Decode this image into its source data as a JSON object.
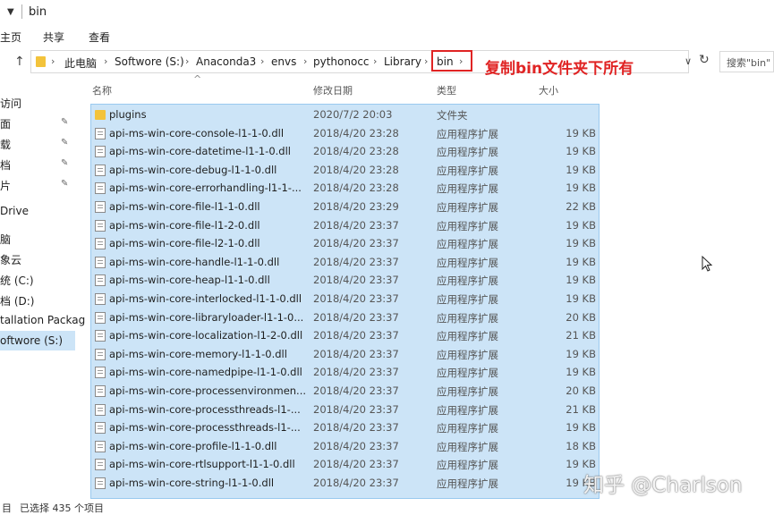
{
  "window": {
    "title": "bin"
  },
  "ribbon": {
    "tabs": [
      "主页",
      "共享",
      "查看"
    ]
  },
  "address": {
    "crumbs": [
      "此电脑",
      "Softwore (S:)",
      "Anaconda3",
      "envs",
      "pythonocc",
      "Library",
      "bin"
    ],
    "search_placeholder": "搜索\"bin\""
  },
  "annotation": {
    "text": "复制bin文件夹下所有",
    "color": "#e02424"
  },
  "nav": {
    "items": [
      "访问",
      "面",
      "载",
      "档",
      "片",
      "Drive",
      "脑",
      "象云",
      "统 (C:)",
      "档 (D:)",
      "tallation Packag",
      "oftwore (S:)"
    ],
    "selected_index": 11
  },
  "columns": {
    "name": "名称",
    "date": "修改日期",
    "type": "类型",
    "size": "大小"
  },
  "files": [
    {
      "name": "plugins",
      "date": "2020/7/2 20:03",
      "type": "文件夹",
      "size": "",
      "kind": "folder"
    },
    {
      "name": "api-ms-win-core-console-l1-1-0.dll",
      "date": "2018/4/20 23:28",
      "type": "应用程序扩展",
      "size": "19 KB",
      "kind": "file"
    },
    {
      "name": "api-ms-win-core-datetime-l1-1-0.dll",
      "date": "2018/4/20 23:28",
      "type": "应用程序扩展",
      "size": "19 KB",
      "kind": "file"
    },
    {
      "name": "api-ms-win-core-debug-l1-1-0.dll",
      "date": "2018/4/20 23:28",
      "type": "应用程序扩展",
      "size": "19 KB",
      "kind": "file"
    },
    {
      "name": "api-ms-win-core-errorhandling-l1-1-...",
      "date": "2018/4/20 23:28",
      "type": "应用程序扩展",
      "size": "19 KB",
      "kind": "file"
    },
    {
      "name": "api-ms-win-core-file-l1-1-0.dll",
      "date": "2018/4/20 23:29",
      "type": "应用程序扩展",
      "size": "22 KB",
      "kind": "file"
    },
    {
      "name": "api-ms-win-core-file-l1-2-0.dll",
      "date": "2018/4/20 23:37",
      "type": "应用程序扩展",
      "size": "19 KB",
      "kind": "file"
    },
    {
      "name": "api-ms-win-core-file-l2-1-0.dll",
      "date": "2018/4/20 23:37",
      "type": "应用程序扩展",
      "size": "19 KB",
      "kind": "file"
    },
    {
      "name": "api-ms-win-core-handle-l1-1-0.dll",
      "date": "2018/4/20 23:37",
      "type": "应用程序扩展",
      "size": "19 KB",
      "kind": "file"
    },
    {
      "name": "api-ms-win-core-heap-l1-1-0.dll",
      "date": "2018/4/20 23:37",
      "type": "应用程序扩展",
      "size": "19 KB",
      "kind": "file"
    },
    {
      "name": "api-ms-win-core-interlocked-l1-1-0.dll",
      "date": "2018/4/20 23:37",
      "type": "应用程序扩展",
      "size": "19 KB",
      "kind": "file"
    },
    {
      "name": "api-ms-win-core-libraryloader-l1-1-0...",
      "date": "2018/4/20 23:37",
      "type": "应用程序扩展",
      "size": "20 KB",
      "kind": "file"
    },
    {
      "name": "api-ms-win-core-localization-l1-2-0.dll",
      "date": "2018/4/20 23:37",
      "type": "应用程序扩展",
      "size": "21 KB",
      "kind": "file"
    },
    {
      "name": "api-ms-win-core-memory-l1-1-0.dll",
      "date": "2018/4/20 23:37",
      "type": "应用程序扩展",
      "size": "19 KB",
      "kind": "file"
    },
    {
      "name": "api-ms-win-core-namedpipe-l1-1-0.dll",
      "date": "2018/4/20 23:37",
      "type": "应用程序扩展",
      "size": "19 KB",
      "kind": "file"
    },
    {
      "name": "api-ms-win-core-processenvironmen...",
      "date": "2018/4/20 23:37",
      "type": "应用程序扩展",
      "size": "20 KB",
      "kind": "file"
    },
    {
      "name": "api-ms-win-core-processthreads-l1-...",
      "date": "2018/4/20 23:37",
      "type": "应用程序扩展",
      "size": "21 KB",
      "kind": "file"
    },
    {
      "name": "api-ms-win-core-processthreads-l1-...",
      "date": "2018/4/20 23:37",
      "type": "应用程序扩展",
      "size": "19 KB",
      "kind": "file"
    },
    {
      "name": "api-ms-win-core-profile-l1-1-0.dll",
      "date": "2018/4/20 23:37",
      "type": "应用程序扩展",
      "size": "18 KB",
      "kind": "file"
    },
    {
      "name": "api-ms-win-core-rtlsupport-l1-1-0.dll",
      "date": "2018/4/20 23:37",
      "type": "应用程序扩展",
      "size": "19 KB",
      "kind": "file"
    },
    {
      "name": "api-ms-win-core-string-l1-1-0.dll",
      "date": "2018/4/20 23:37",
      "type": "应用程序扩展",
      "size": "19 KB",
      "kind": "file"
    }
  ],
  "status": {
    "count": "目",
    "selected": "已选择 435 个项目"
  },
  "watermark": "知乎 @Charlson",
  "colors": {
    "selection": "#cce4f7",
    "selection_border": "#99c9ef",
    "folder": "#f3c33b"
  }
}
